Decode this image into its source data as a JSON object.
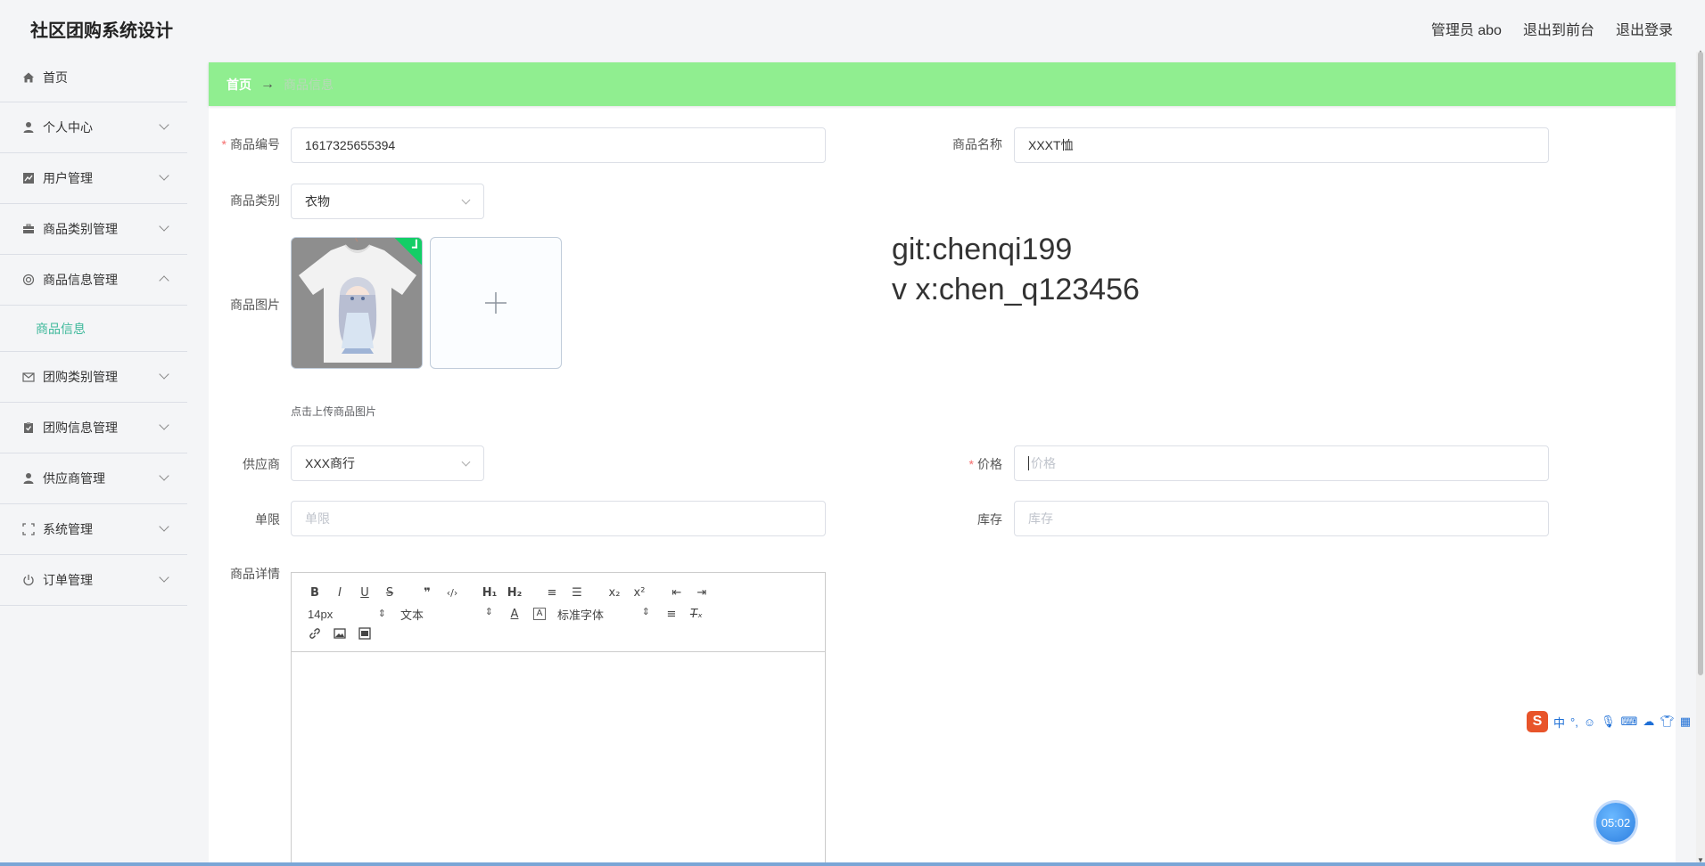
{
  "app": {
    "title": "社区团购系统设计"
  },
  "header": {
    "user": "管理员 abo",
    "to_front": "退出到前台",
    "logout": "退出登录"
  },
  "sidebar": {
    "items": [
      {
        "label": "首页",
        "icon": "home-icon"
      },
      {
        "label": "个人中心",
        "icon": "user-icon"
      },
      {
        "label": "用户管理",
        "icon": "chart-icon"
      },
      {
        "label": "商品类别管理",
        "icon": "briefcase-icon"
      },
      {
        "label": "商品信息管理",
        "icon": "settings-ring-icon"
      },
      {
        "label": "商品信息",
        "icon": ""
      },
      {
        "label": "团购类别管理",
        "icon": "mail-icon"
      },
      {
        "label": "团购信息管理",
        "icon": "clipboard-icon"
      },
      {
        "label": "供应商管理",
        "icon": "person-icon"
      },
      {
        "label": "系统管理",
        "icon": "fullscreen-icon"
      },
      {
        "label": "订单管理",
        "icon": "power-icon"
      }
    ]
  },
  "breadcrumb": {
    "home": "首页",
    "separator": "→",
    "current": "商品信息"
  },
  "form": {
    "product_no": {
      "label": "商品编号",
      "value": "1617325655394"
    },
    "product_name": {
      "label": "商品名称",
      "value": "XXXT恤"
    },
    "category": {
      "label": "商品类别",
      "value": "衣物"
    },
    "image": {
      "label": "商品图片",
      "tip": "点击上传商品图片"
    },
    "supplier": {
      "label": "供应商",
      "value": "XXX商行"
    },
    "price": {
      "label": "价格",
      "placeholder": "价格"
    },
    "limit": {
      "label": "单限",
      "placeholder": "单限"
    },
    "stock": {
      "label": "库存",
      "placeholder": "库存"
    },
    "detail": {
      "label": "商品详情"
    }
  },
  "editor": {
    "size": "14px",
    "format": "文本",
    "font": "标准字体"
  },
  "watermark": {
    "line1": "git:chenqi199",
    "line2": "v x:chen_q123456"
  },
  "ime": {
    "logo": "S",
    "lang": "中",
    "punct": "°,"
  },
  "timer": "05:02",
  "colors": {
    "accent": "#3cb89a",
    "breadcrumb_bg": "#90ee90",
    "required": "#f56c6c"
  }
}
